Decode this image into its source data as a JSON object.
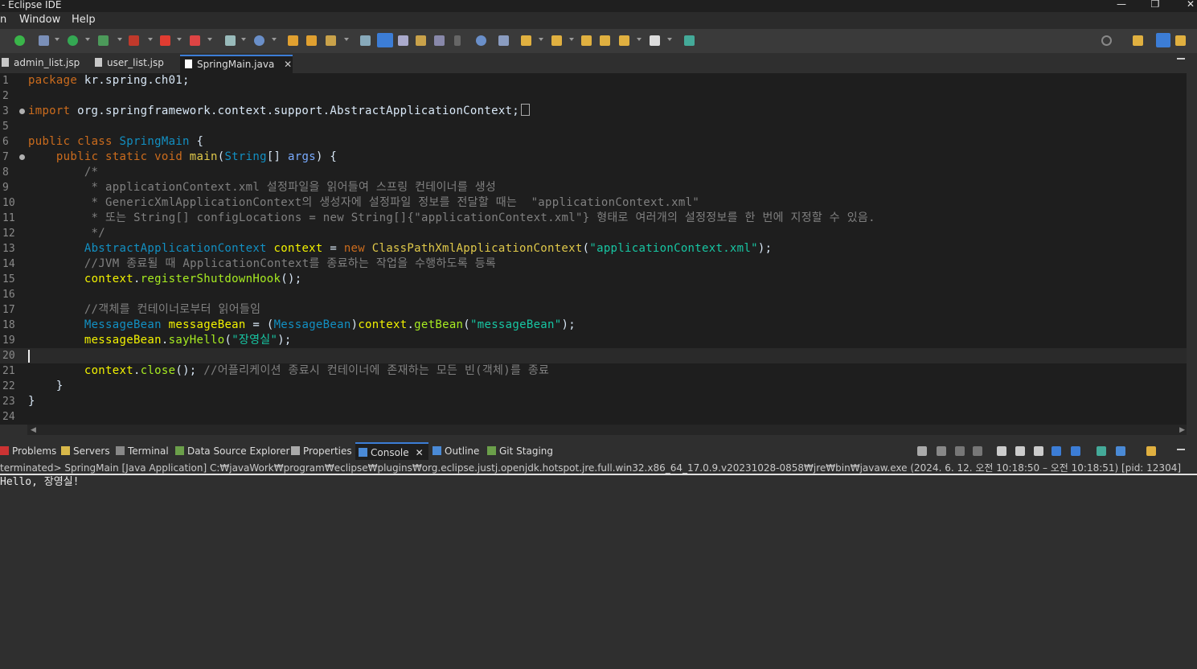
{
  "window": {
    "title": "- Eclipse IDE",
    "minimize": "—",
    "maximize": "❐",
    "close": "✕"
  },
  "menu": {
    "items": [
      "n",
      "Window",
      "Help"
    ]
  },
  "editor_tabs": [
    {
      "label": "admin_list.jsp"
    },
    {
      "label": "user_list.jsp"
    },
    {
      "label": "SpringMain.java",
      "active": true
    }
  ],
  "editor": {
    "file": "SpringMain.java",
    "line_numbers": [
      "1",
      "2",
      "3",
      "5",
      "6",
      "7",
      "8",
      "9",
      "10",
      "11",
      "12",
      "13",
      "14",
      "15",
      "16",
      "17",
      "18",
      "19",
      "20",
      "21",
      "22",
      "23",
      "24"
    ]
  },
  "bottom_tabs": [
    {
      "label": "Problems"
    },
    {
      "label": "Servers"
    },
    {
      "label": "Terminal"
    },
    {
      "label": "Data Source Explorer"
    },
    {
      "label": "Properties"
    },
    {
      "label": "Console",
      "active": true
    },
    {
      "label": "Outline"
    },
    {
      "label": "Git Staging"
    }
  ],
  "console": {
    "header": "terminated> SpringMain [Java Application] C:₩javaWork₩program₩eclipse₩plugins₩org.eclipse.justj.openjdk.hotspot.jre.full.win32.x86_64_17.0.9.v20231028-0858₩jre₩bin₩javaw.exe  (2024. 6. 12. 오전 10:18:50 – 오전 10:18:51) [pid: 12304]",
    "output": "Hello, 장영실!"
  },
  "colors": {
    "keyword": "#cc6c1d",
    "type": "#1290c3",
    "string": "#17c6a3",
    "comment": "#808080",
    "accent": "#3c7dd6"
  },
  "code_tokens": {
    "l1": [
      "package",
      " kr.spring.ch01;"
    ],
    "l3": [
      "import",
      " org.springframework.context.support.AbstractApplicationContext;"
    ],
    "l6": [
      "public",
      " ",
      "class",
      " ",
      "SpringMain",
      " {"
    ],
    "l7": [
      "    ",
      "public",
      " ",
      "static",
      " ",
      "void",
      " ",
      "main",
      "(",
      "String",
      "[] ",
      "args",
      ") {"
    ],
    "l8": "        /*",
    "l9": "         * applicationContext.xml 설정파일을 읽어들여 스프링 컨테이너를 생성",
    "l10": "         * GenericXmlApplicationContext의 생성자에 설정파일 정보를 전달할 때는  \"applicationContext.xml\"",
    "l11": "         * 또는 String[] configLocations = new String[]{\"applicationContext.xml\"} 형태로 여러개의 설정정보를 한 번에 지정할 수 있음.",
    "l12": "         */",
    "l13": [
      "        ",
      "AbstractApplicationContext",
      " ",
      "context",
      " = ",
      "new",
      " ",
      "ClassPathXmlApplicationContext",
      "(",
      "\"applicationContext.xml\"",
      ");"
    ],
    "l14": "        //JVM 종료될 때 ApplicationContext를 종료하는 작업을 수행하도록 등록",
    "l15": [
      "        ",
      "context",
      ".",
      "registerShutdownHook",
      "();"
    ],
    "l17": "        //객체를 컨테이너로부터 읽어들임",
    "l18": [
      "        ",
      "MessageBean",
      " ",
      "messageBean",
      " = (",
      "MessageBean",
      ")",
      "context",
      ".",
      "getBean",
      "(",
      "\"messageBean\"",
      ");"
    ],
    "l19": [
      "        ",
      "messageBean",
      ".",
      "sayHello",
      "(",
      "\"장영실\"",
      ");"
    ],
    "l21": [
      "        ",
      "context",
      ".",
      "close",
      "(); ",
      "//어플리케이션 종료시 컨테이너에 존재하는 모든 빈(객체)를 종료"
    ],
    "l22": "    }",
    "l23": "}"
  }
}
